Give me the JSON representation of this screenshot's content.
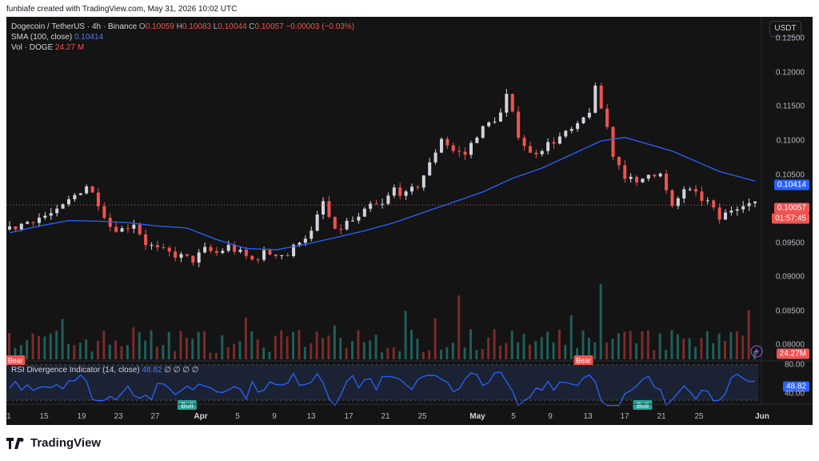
{
  "header": {
    "created_line": "funbiafe created with TradingView.com, May 31, 2026 10:02 UTC"
  },
  "legend": {
    "symbol": "Dogecoin / TetherUS · 4h · Binance",
    "o_label": "O",
    "o": "0.10059",
    "h_label": "H",
    "h": "0.10083",
    "l_label": "L",
    "l": "0.10044",
    "c_label": "C",
    "c": "0.10057",
    "change": "−0.00003 (−0.03%)",
    "sma_label": "SMA (100, close)",
    "sma_value": "0.10414",
    "vol_label": "Vol · DOGE",
    "vol_value": "24.27 M"
  },
  "rsi_legend": {
    "label": "RSI Divergence Indicator (14, close)",
    "value": "48.82",
    "extras": "∅ ∅ ∅ ∅"
  },
  "currency": "USDT",
  "colors": {
    "up": "#d1d4dc",
    "down": "#ef5350",
    "sma": "#2962ff",
    "rsi": "#2962ff",
    "bull": "#26a69a",
    "bear": "#ef5350"
  },
  "chart_data": {
    "type": "candlestick",
    "y_ticks": [
      "0.12500",
      "0.12000",
      "0.11500",
      "0.11000",
      "0.10500",
      "0.10000",
      "0.09500",
      "0.09000",
      "0.08500",
      "0.08000"
    ],
    "y_range": [
      0.0777,
      0.1282
    ],
    "price_tag": "0.10057",
    "countdown": "01:57:45",
    "sma_tag": "0.10414",
    "vol_tag": "24.27M",
    "x_ticks": [
      "1",
      "15",
      "19",
      "23",
      "27",
      "Apr",
      "5",
      "9",
      "13",
      "17",
      "21",
      "25",
      "May",
      "5",
      "9",
      "13",
      "17",
      "21",
      "25",
      "Jun"
    ],
    "close_path": [
      [
        0,
        0.097
      ],
      [
        4,
        0.0985
      ],
      [
        8,
        0.0995
      ],
      [
        11,
        0.102
      ],
      [
        13,
        0.1035
      ],
      [
        15,
        0.101
      ],
      [
        17,
        0.0975
      ],
      [
        19,
        0.097
      ],
      [
        21,
        0.098
      ],
      [
        23,
        0.095
      ],
      [
        25,
        0.094
      ],
      [
        27,
        0.0935
      ],
      [
        29,
        0.093
      ],
      [
        31,
        0.0925
      ],
      [
        33,
        0.094
      ],
      [
        35,
        0.0935
      ],
      [
        37,
        0.0945
      ],
      [
        39,
        0.0935
      ],
      [
        41,
        0.0925
      ],
      [
        43,
        0.0935
      ],
      [
        45,
        0.0935
      ],
      [
        47,
        0.0932
      ],
      [
        49,
        0.0955
      ],
      [
        51,
        0.0965
      ],
      [
        53,
        0.101
      ],
      [
        55,
        0.0965
      ],
      [
        57,
        0.098
      ],
      [
        59,
        0.0985
      ],
      [
        61,
        0.1005
      ],
      [
        63,
        0.1005
      ],
      [
        65,
        0.103
      ],
      [
        67,
        0.102
      ],
      [
        69,
        0.1035
      ],
      [
        71,
        0.1065
      ],
      [
        73,
        0.1105
      ],
      [
        75,
        0.1085
      ],
      [
        77,
        0.108
      ],
      [
        79,
        0.111
      ],
      [
        81,
        0.1125
      ],
      [
        83,
        0.114
      ],
      [
        84,
        0.1165
      ],
      [
        86,
        0.111
      ],
      [
        88,
        0.108
      ],
      [
        90,
        0.109
      ],
      [
        92,
        0.11
      ],
      [
        94,
        0.111
      ],
      [
        96,
        0.112
      ],
      [
        98,
        0.1145
      ],
      [
        99,
        0.1175
      ],
      [
        101,
        0.112
      ],
      [
        102,
        0.108
      ],
      [
        104,
        0.105
      ],
      [
        106,
        0.1035
      ],
      [
        108,
        0.1055
      ],
      [
        110,
        0.105
      ],
      [
        112,
        0.1
      ],
      [
        114,
        0.103
      ],
      [
        116,
        0.102
      ],
      [
        118,
        0.101
      ],
      [
        120,
        0.0985
      ],
      [
        122,
        0.1
      ],
      [
        124,
        0.101
      ],
      [
        126,
        0.1006
      ]
    ],
    "sma_path": [
      [
        0,
        0.0965
      ],
      [
        5,
        0.0975
      ],
      [
        10,
        0.0983
      ],
      [
        15,
        0.0982
      ],
      [
        20,
        0.098
      ],
      [
        25,
        0.0975
      ],
      [
        30,
        0.0972
      ],
      [
        35,
        0.0955
      ],
      [
        40,
        0.0942
      ],
      [
        45,
        0.094
      ],
      [
        50,
        0.0948
      ],
      [
        55,
        0.0958
      ],
      [
        60,
        0.0968
      ],
      [
        65,
        0.098
      ],
      [
        70,
        0.0995
      ],
      [
        75,
        0.101
      ],
      [
        80,
        0.1025
      ],
      [
        85,
        0.1045
      ],
      [
        90,
        0.106
      ],
      [
        95,
        0.108
      ],
      [
        100,
        0.11
      ],
      [
        104,
        0.1105
      ],
      [
        108,
        0.1095
      ],
      [
        112,
        0.1085
      ],
      [
        116,
        0.107
      ],
      [
        120,
        0.1055
      ],
      [
        126,
        0.1041
      ]
    ],
    "rsi": {
      "ticks": [
        "80.00",
        "40.00"
      ],
      "value_tag": "48.82",
      "labels": [
        {
          "text": "Bear",
          "kind": "bear",
          "i": 1
        },
        {
          "text": "Bull",
          "kind": "bull",
          "i": 30
        },
        {
          "text": "Bear",
          "kind": "bear",
          "i": 97
        },
        {
          "text": "Bull",
          "kind": "bull",
          "i": 107
        }
      ]
    }
  },
  "footer": {
    "brand": "TradingView"
  }
}
